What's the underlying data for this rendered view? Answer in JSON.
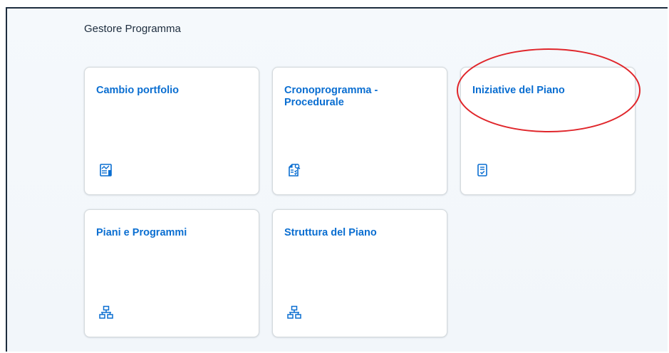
{
  "group": {
    "title": "Gestore Programma"
  },
  "tiles": [
    {
      "title": "Cambio portfolio",
      "icon": "portfolio-chart-icon"
    },
    {
      "title": "Cronoprogramma - Procedurale",
      "icon": "document-search-icon"
    },
    {
      "title": "Iniziative del Piano",
      "icon": "checklist-icon"
    },
    {
      "title": "Piani e Programmi",
      "icon": "hierarchy-icon"
    },
    {
      "title": "Struttura del Piano",
      "icon": "hierarchy-icon"
    }
  ],
  "colors": {
    "tile_title": "#0a6ed1",
    "annotation_ellipse": "#e0262b",
    "icon": "#0a6ed1"
  }
}
